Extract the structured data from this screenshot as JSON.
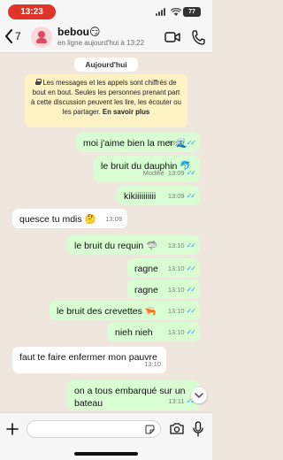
{
  "status_bar": {
    "time": "13:23",
    "battery": "77"
  },
  "header": {
    "back_count": "7",
    "contact_name": "bebou😏",
    "contact_status": "en ligne aujourd'hui à 13:22",
    "icons": [
      "chevron-left-icon",
      "avatar",
      "video-call-icon",
      "phone-icon"
    ]
  },
  "chat": {
    "date_chip": "Aujourd'hui",
    "notice": {
      "text": "Les messages et les appels sont chiffrés de bout en bout. Seules les personnes prenant part à cette discussion peuvent les lire, les écouter ou les partager.",
      "learn_more": "En savoir plus"
    },
    "messages": [
      {
        "dir": "out",
        "text": "moi j'aime bien la mer 🌊",
        "time": "13:09",
        "edited": ""
      },
      {
        "dir": "out",
        "text": "le bruit du dauphin 🐬",
        "time": "13:09",
        "edited": "Modifié"
      },
      {
        "dir": "out",
        "text": "kikiiiiiiiiii",
        "time": "13:09",
        "edited": ""
      },
      {
        "dir": "in",
        "text": "quesce tu mdis 🤔",
        "time": "13:09",
        "edited": ""
      },
      {
        "dir": "out",
        "text": "le bruit du requin 🦈",
        "time": "13:10",
        "edited": ""
      },
      {
        "dir": "out",
        "text": "ragne",
        "time": "13:10",
        "edited": ""
      },
      {
        "dir": "out",
        "text": "ragne",
        "time": "13:10",
        "edited": ""
      },
      {
        "dir": "out",
        "text": "le bruit des crevettes 🦐",
        "time": "13:10",
        "edited": ""
      },
      {
        "dir": "out",
        "text": "nieh nieh",
        "time": "13:10",
        "edited": ""
      },
      {
        "dir": "in",
        "text": "faut te faire enfermer mon pauvre",
        "time": "13:10",
        "edited": ""
      },
      {
        "dir": "out",
        "text": "on a tous embarqué sur un bateau",
        "time": "13:11",
        "edited": ""
      }
    ]
  },
  "input_bar": {
    "placeholder": "",
    "icons": [
      "plus-icon",
      "sticker-icon",
      "camera-icon",
      "microphone-icon"
    ]
  },
  "colors": {
    "chat_bg": "#efe7de",
    "outgoing_bubble": "#d9fdd3",
    "incoming_bubble": "#ffffff",
    "read_ticks": "#3f94e0",
    "time_pill": "#e0342b"
  }
}
